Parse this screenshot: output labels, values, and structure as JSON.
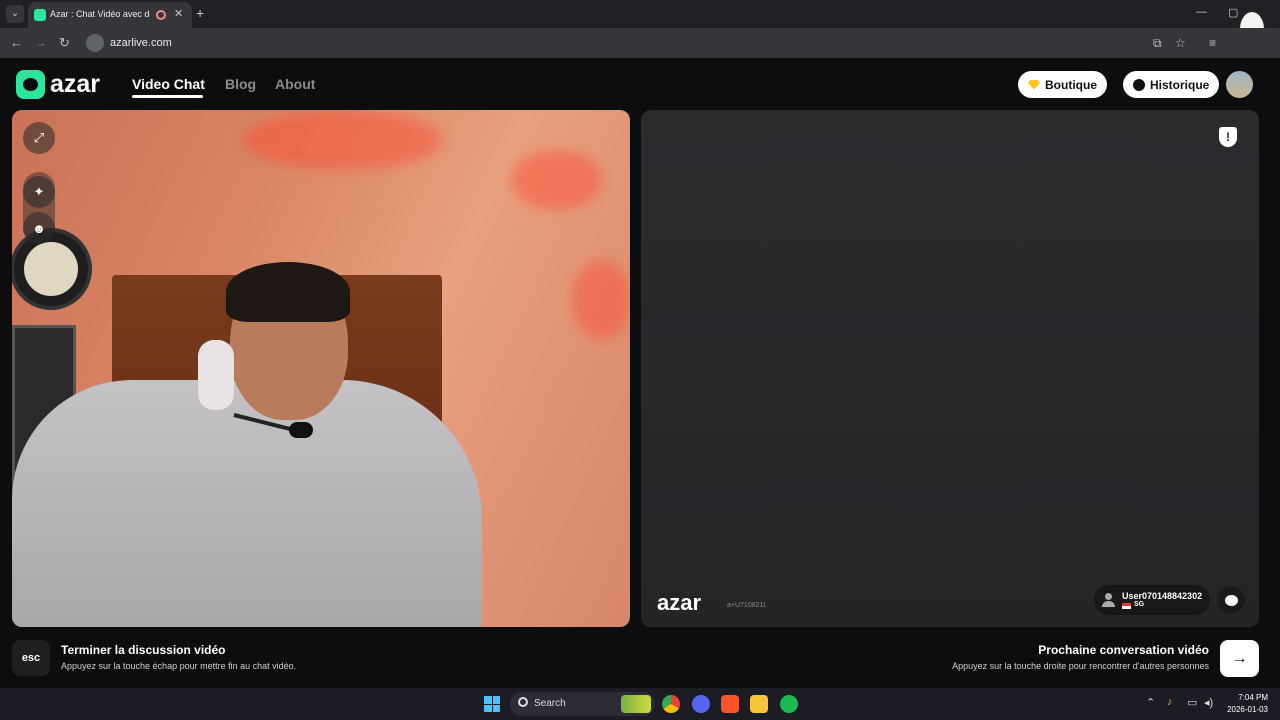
{
  "browser": {
    "tab_title": "Azar : Chat Vidéo avec de n",
    "tab_close": "✕",
    "new_tab": "+",
    "url": "azarlive.com",
    "minimize": "—",
    "maximize": "▢",
    "close": "✕"
  },
  "header": {
    "logo": "azar",
    "nav": [
      "Video Chat",
      "Blog",
      "About"
    ],
    "boutique_label": "Boutique",
    "historique_label": "Historique"
  },
  "local_video": {
    "tools": [
      "expand-icon",
      "sparkle-icon",
      "face-icon"
    ]
  },
  "remote_video": {
    "report_icon": "!",
    "watermark_logo": "azar",
    "watermark_id": "a+U710821t",
    "peer_name": "User070148842302",
    "peer_country": "SG"
  },
  "footer": {
    "esc_key": "esc",
    "end_title": "Terminer la discussion vidéo",
    "end_sub": "Appuyez sur la touche échap pour mettre fin au chat vidéo.",
    "next_title": "Prochaine conversation vidéo",
    "next_sub": "Appuyez sur la touche droite pour rencontrer d'autres personnes",
    "next_arrow": "→"
  },
  "taskbar": {
    "search_label": "Search",
    "time": "7:04 PM",
    "date": "2026-01-03"
  },
  "colors": {
    "brand": "#2ee59d",
    "background": "#0d0d0f"
  }
}
